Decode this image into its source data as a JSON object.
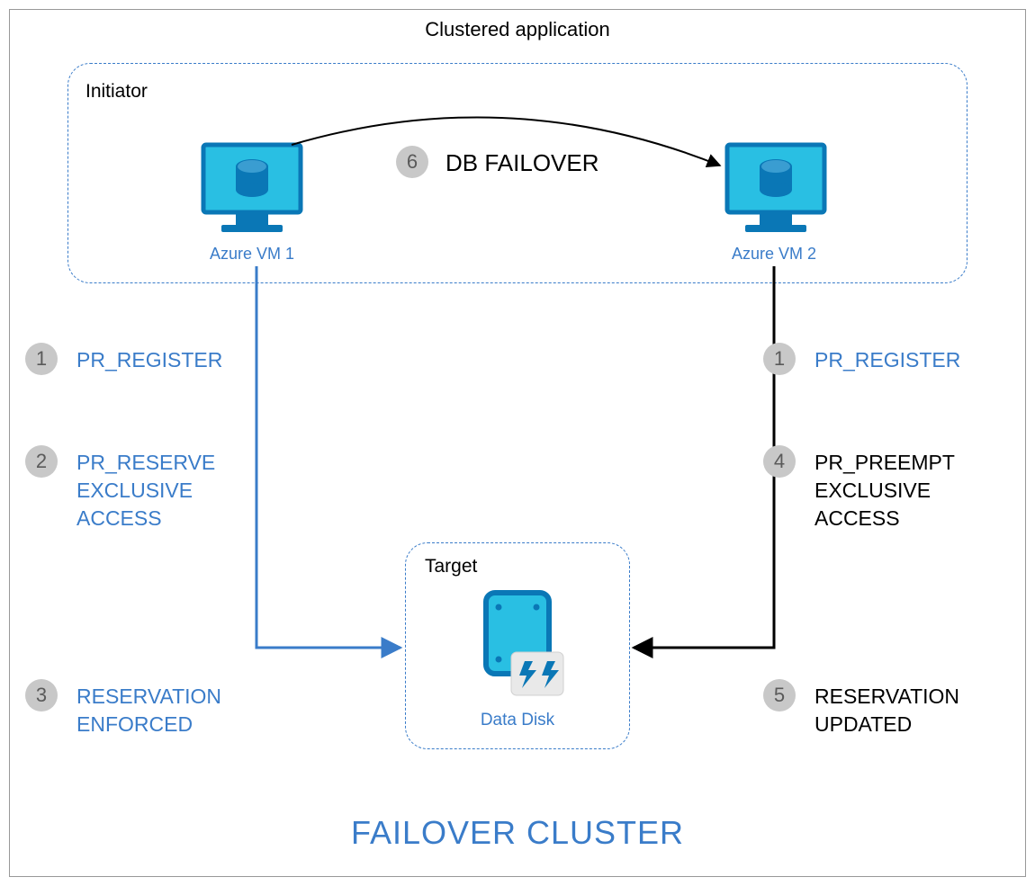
{
  "title": "Clustered application",
  "footer_title": "FAILOVER CLUSTER",
  "initiator": {
    "label": "Initiator"
  },
  "target": {
    "label": "Target"
  },
  "vm1": {
    "label": "Azure VM 1"
  },
  "vm2": {
    "label": "Azure VM 2"
  },
  "disk": {
    "label": "Data Disk"
  },
  "steps": {
    "s1a": {
      "num": "1",
      "text": "PR_REGISTER"
    },
    "s2": {
      "num": "2",
      "text": "PR_RESERVE\nEXCLUSIVE\nACCESS"
    },
    "s3": {
      "num": "3",
      "text": "RESERVATION\nENFORCED"
    },
    "s1b": {
      "num": "1",
      "text": "PR_REGISTER"
    },
    "s4": {
      "num": "4",
      "text": "PR_PREEMPT\nEXCLUSIVE\nACCESS"
    },
    "s5": {
      "num": "5",
      "text": "RESERVATION\nUPDATED"
    },
    "s6": {
      "num": "6",
      "text": "DB FAILOVER"
    }
  },
  "colors": {
    "azure_blue": "#3a7cc9",
    "azure_cyan": "#29bfe3",
    "badge_grey": "#c8c8c8"
  }
}
